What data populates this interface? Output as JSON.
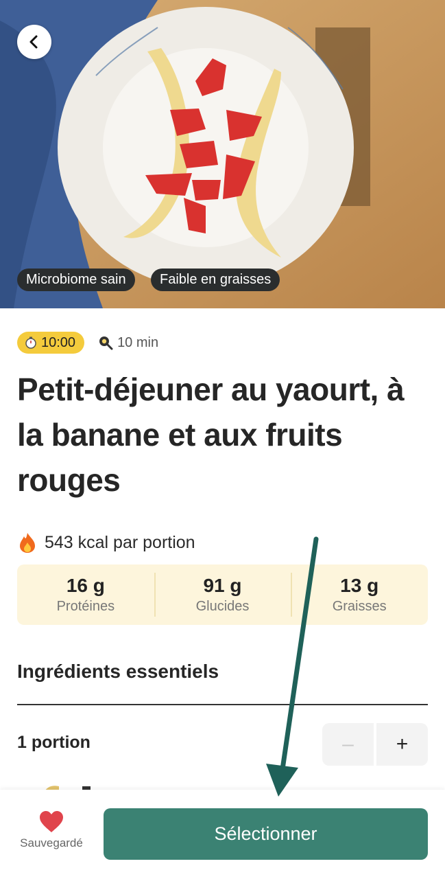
{
  "hero": {
    "tags": [
      "Microbiome sain",
      "Faible en graisses"
    ]
  },
  "meta": {
    "time": "10:00",
    "duration": "10 min"
  },
  "title": "Petit-déjeuner au yaourt, à la banane et aux fruits rouges",
  "calories": "543 kcal par portion",
  "macros": [
    {
      "value": "16 g",
      "label": "Protéines"
    },
    {
      "value": "91 g",
      "label": "Glucides"
    },
    {
      "value": "13 g",
      "label": "Graisses"
    }
  ],
  "ingredients": {
    "title": "Ingrédients essentiels",
    "portion": "1 portion",
    "minus": "–",
    "plus": "+"
  },
  "bottom": {
    "save_label": "Sauvegardé",
    "select_label": "Sélectionner"
  },
  "colors": {
    "accent": "#3b8273",
    "time_badge": "#f4cb3c",
    "macro_bg": "#fdf5dc",
    "heart": "#e0444c",
    "annotation_arrow": "#1f6159"
  },
  "icons": [
    "chevron-left-icon",
    "stopwatch-icon",
    "pan-icon",
    "fire-icon",
    "heart-icon"
  ]
}
